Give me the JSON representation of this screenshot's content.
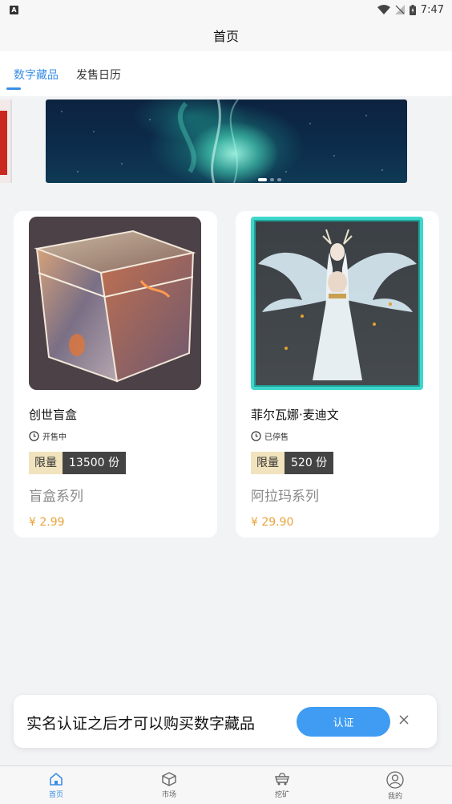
{
  "status_bar": {
    "time": "7:47",
    "notification_icon_text": "A"
  },
  "header": {
    "title": "首页"
  },
  "tabs": [
    {
      "label": "数字藏品",
      "active": true
    },
    {
      "label": "发售日历",
      "active": false
    }
  ],
  "products": [
    {
      "title": "创世盲盒",
      "status": "开售中",
      "limit_label": "限量",
      "limit_count": "13500 份",
      "series": "盲盒系列",
      "price": "¥ 2.99"
    },
    {
      "title": "菲尔瓦娜·麦迪文",
      "status": "已停售",
      "limit_label": "限量",
      "limit_count": "520 份",
      "series": "阿拉玛系列",
      "price": "¥ 29.90"
    }
  ],
  "toast": {
    "message": "实名认证之后才可以购买数字藏品",
    "button_label": "认证"
  },
  "bottom_nav": [
    {
      "label": "首页",
      "icon": "home-icon",
      "active": true
    },
    {
      "label": "市场",
      "icon": "cube-icon",
      "active": false
    },
    {
      "label": "挖矿",
      "icon": "mining-cart-icon",
      "active": false
    },
    {
      "label": "我的",
      "icon": "user-icon",
      "active": false
    }
  ],
  "colors": {
    "accent": "#3a8ee6",
    "price": "#e8a33b",
    "button": "#3f9cf2"
  }
}
